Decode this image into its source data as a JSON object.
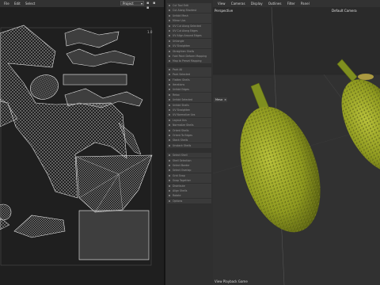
{
  "uv_editor": {
    "menu": [
      "File",
      "Edit",
      "Select"
    ],
    "project_select": "Project",
    "tool_icons": [
      "lock-icon",
      "gear-icon",
      "dots-icon"
    ],
    "corner_label": "1.0"
  },
  "command_panel": {
    "items": [
      "Cut Tool Edit",
      "Cut Along Shortest",
      "Unfold Mesh",
      "Mirror Uvs",
      "UV Cut Along Selected",
      "UV Cut Along Edges",
      "UV Align Around Edges",
      "Untangle",
      "UV Straighten",
      "Straighten Shells",
      "Fold Point Deform Mapping",
      "Map to Preset Mapping",
      "Pack All",
      "Pack Selected",
      "Flatten Shells",
      "Iterations",
      "Unfold Edges",
      "Relax",
      "Unfold Selected",
      "Unfold Shells",
      "UV Straighten",
      "UV Normalize Uvs",
      "Layout Uvs",
      "Normalize Shells",
      "Orient Shells",
      "Orient To Edges",
      "Stack Shells",
      "Unstack Shells",
      "Select Shell",
      "Shell Selection",
      "Select Border",
      "Select Overlap",
      "Grid Snap",
      "Snap Together",
      "Distribute",
      "Align Shells",
      "Rotate",
      "Options"
    ]
  },
  "viewport": {
    "menu": [
      "View",
      "Cameras",
      "Display",
      "Outlines",
      "Filter",
      "Panel"
    ],
    "perspective_label": "Perspective",
    "camera_label": "Default Camera",
    "mesh_tag": "Mesa",
    "status": "View Playback Game"
  },
  "colors": {
    "fruit_green": "#9aa62a",
    "fruit_dark": "#5c6410",
    "stem": "#7a8a1c",
    "wire": "#e8e8e8"
  }
}
